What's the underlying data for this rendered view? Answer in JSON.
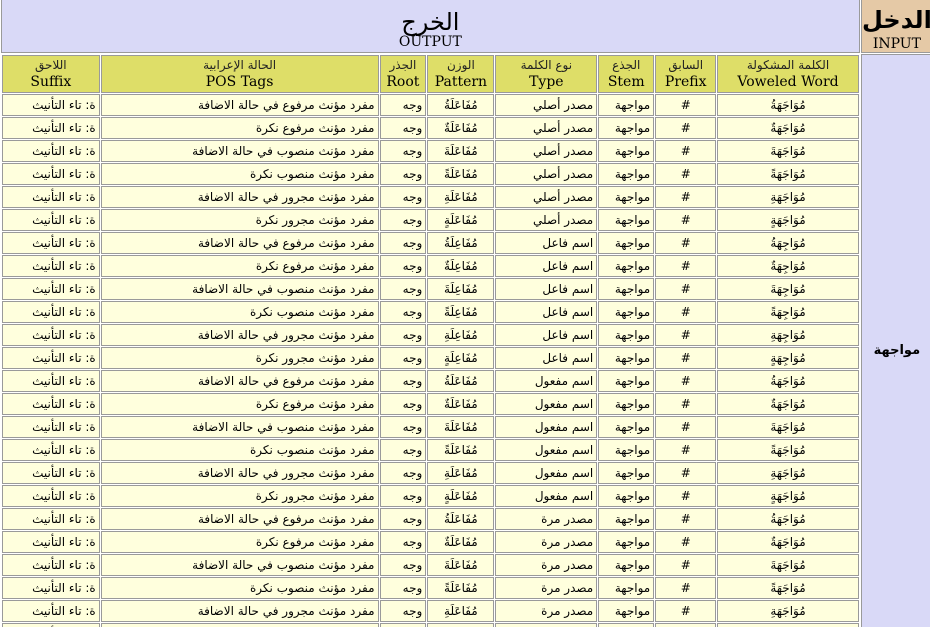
{
  "header": {
    "output_ar": "الخرج",
    "output_en": "OUTPUT",
    "input_ar": "الدخل",
    "input_en": "INPUT"
  },
  "input_word": "مواجهة",
  "columns": [
    {
      "ar": "اللاحق",
      "en": "Suffix"
    },
    {
      "ar": "الحالة الإعرابية",
      "en": "POS Tags"
    },
    {
      "ar": "الجذر",
      "en": "Root"
    },
    {
      "ar": "الوزن",
      "en": "Pattern"
    },
    {
      "ar": "نوع الكلمة",
      "en": "Type"
    },
    {
      "ar": "الجذع",
      "en": "Stem"
    },
    {
      "ar": "السابق",
      "en": "Prefix"
    },
    {
      "ar": "الكلمة المشكولة",
      "en": "Voweled Word"
    }
  ],
  "rows": [
    {
      "suffix": "ة: تاء التأنيث",
      "pos": "مفرد مؤنث مرفوع في حالة الاضافة",
      "root": "وجه",
      "pattern": "مُفَاعَلَةُ",
      "type": "مصدر أصلي",
      "stem": "مواجهة",
      "prefix": "#",
      "voweled": "مُوَاجَهَةُ"
    },
    {
      "suffix": "ة: تاء التأنيث",
      "pos": "مفرد مؤنث مرفوع نكرة",
      "root": "وجه",
      "pattern": "مُفَاعَلَةٌ",
      "type": "مصدر أصلي",
      "stem": "مواجهة",
      "prefix": "#",
      "voweled": "مُوَاجَهَةٌ"
    },
    {
      "suffix": "ة: تاء التأنيث",
      "pos": "مفرد مؤنث منصوب في حالة الاضافة",
      "root": "وجه",
      "pattern": "مُفَاعَلَةَ",
      "type": "مصدر أصلي",
      "stem": "مواجهة",
      "prefix": "#",
      "voweled": "مُوَاجَهَةَ"
    },
    {
      "suffix": "ة: تاء التأنيث",
      "pos": "مفرد مؤنث منصوب نكرة",
      "root": "وجه",
      "pattern": "مُفَاعَلَةً",
      "type": "مصدر أصلي",
      "stem": "مواجهة",
      "prefix": "#",
      "voweled": "مُوَاجَهَةً"
    },
    {
      "suffix": "ة: تاء التأنيث",
      "pos": "مفرد مؤنث مجرور في حالة الاضافة",
      "root": "وجه",
      "pattern": "مُفَاعَلَةِ",
      "type": "مصدر أصلي",
      "stem": "مواجهة",
      "prefix": "#",
      "voweled": "مُوَاجَهَةِ"
    },
    {
      "suffix": "ة: تاء التأنيث",
      "pos": "مفرد مؤنث مجرور نكرة",
      "root": "وجه",
      "pattern": "مُفَاعَلَةٍ",
      "type": "مصدر أصلي",
      "stem": "مواجهة",
      "prefix": "#",
      "voweled": "مُوَاجَهَةٍ"
    },
    {
      "suffix": "ة: تاء التأنيث",
      "pos": "مفرد مؤنث مرفوع في حالة الاضافة",
      "root": "وجه",
      "pattern": "مُفَاعِلَةُ",
      "type": "اسم فاعل",
      "stem": "مواجهة",
      "prefix": "#",
      "voweled": "مُوَاجِهَةُ"
    },
    {
      "suffix": "ة: تاء التأنيث",
      "pos": "مفرد مؤنث مرفوع نكرة",
      "root": "وجه",
      "pattern": "مُفَاعِلَةٌ",
      "type": "اسم فاعل",
      "stem": "مواجهة",
      "prefix": "#",
      "voweled": "مُوَاجِهَةٌ"
    },
    {
      "suffix": "ة: تاء التأنيث",
      "pos": "مفرد مؤنث منصوب في حالة الاضافة",
      "root": "وجه",
      "pattern": "مُفَاعِلَةَ",
      "type": "اسم فاعل",
      "stem": "مواجهة",
      "prefix": "#",
      "voweled": "مُوَاجِهَةَ"
    },
    {
      "suffix": "ة: تاء التأنيث",
      "pos": "مفرد مؤنث منصوب نكرة",
      "root": "وجه",
      "pattern": "مُفَاعِلَةً",
      "type": "اسم فاعل",
      "stem": "مواجهة",
      "prefix": "#",
      "voweled": "مُوَاجِهَةً"
    },
    {
      "suffix": "ة: تاء التأنيث",
      "pos": "مفرد مؤنث مجرور في حالة الاضافة",
      "root": "وجه",
      "pattern": "مُفَاعِلَةِ",
      "type": "اسم فاعل",
      "stem": "مواجهة",
      "prefix": "#",
      "voweled": "مُوَاجِهَةِ"
    },
    {
      "suffix": "ة: تاء التأنيث",
      "pos": "مفرد مؤنث مجرور نكرة",
      "root": "وجه",
      "pattern": "مُفَاعِلَةٍ",
      "type": "اسم فاعل",
      "stem": "مواجهة",
      "prefix": "#",
      "voweled": "مُوَاجِهَةٍ"
    },
    {
      "suffix": "ة: تاء التأنيث",
      "pos": "مفرد مؤنث مرفوع في حالة الاضافة",
      "root": "وجه",
      "pattern": "مُفَاعَلَةُ",
      "type": "اسم مفعول",
      "stem": "مواجهة",
      "prefix": "#",
      "voweled": "مُوَاجَهَةُ"
    },
    {
      "suffix": "ة: تاء التأنيث",
      "pos": "مفرد مؤنث مرفوع نكرة",
      "root": "وجه",
      "pattern": "مُفَاعَلَةٌ",
      "type": "اسم مفعول",
      "stem": "مواجهة",
      "prefix": "#",
      "voweled": "مُوَاجَهَةٌ"
    },
    {
      "suffix": "ة: تاء التأنيث",
      "pos": "مفرد مؤنث منصوب في حالة الاضافة",
      "root": "وجه",
      "pattern": "مُفَاعَلَةَ",
      "type": "اسم مفعول",
      "stem": "مواجهة",
      "prefix": "#",
      "voweled": "مُوَاجَهَةَ"
    },
    {
      "suffix": "ة: تاء التأنيث",
      "pos": "مفرد مؤنث منصوب نكرة",
      "root": "وجه",
      "pattern": "مُفَاعَلَةً",
      "type": "اسم مفعول",
      "stem": "مواجهة",
      "prefix": "#",
      "voweled": "مُوَاجَهَةً"
    },
    {
      "suffix": "ة: تاء التأنيث",
      "pos": "مفرد مؤنث مجرور في حالة الاضافة",
      "root": "وجه",
      "pattern": "مُفَاعَلَةِ",
      "type": "اسم مفعول",
      "stem": "مواجهة",
      "prefix": "#",
      "voweled": "مُوَاجَهَةِ"
    },
    {
      "suffix": "ة: تاء التأنيث",
      "pos": "مفرد مؤنث مجرور نكرة",
      "root": "وجه",
      "pattern": "مُفَاعَلَةٍ",
      "type": "اسم مفعول",
      "stem": "مواجهة",
      "prefix": "#",
      "voweled": "مُوَاجَهَةٍ"
    },
    {
      "suffix": "ة: تاء التأنيث",
      "pos": "مفرد مؤنث مرفوع في حالة الاضافة",
      "root": "وجه",
      "pattern": "مُفَاعَلَةُ",
      "type": "مصدر مرة",
      "stem": "مواجهة",
      "prefix": "#",
      "voweled": "مُوَاجَهَةُ"
    },
    {
      "suffix": "ة: تاء التأنيث",
      "pos": "مفرد مؤنث مرفوع نكرة",
      "root": "وجه",
      "pattern": "مُفَاعَلَةٌ",
      "type": "مصدر مرة",
      "stem": "مواجهة",
      "prefix": "#",
      "voweled": "مُوَاجَهَةٌ"
    },
    {
      "suffix": "ة: تاء التأنيث",
      "pos": "مفرد مؤنث منصوب في حالة الاضافة",
      "root": "وجه",
      "pattern": "مُفَاعَلَةَ",
      "type": "مصدر مرة",
      "stem": "مواجهة",
      "prefix": "#",
      "voweled": "مُوَاجَهَةَ"
    },
    {
      "suffix": "ة: تاء التأنيث",
      "pos": "مفرد مؤنث منصوب نكرة",
      "root": "وجه",
      "pattern": "مُفَاعَلَةً",
      "type": "مصدر مرة",
      "stem": "مواجهة",
      "prefix": "#",
      "voweled": "مُوَاجَهَةً"
    },
    {
      "suffix": "ة: تاء التأنيث",
      "pos": "مفرد مؤنث مجرور في حالة الاضافة",
      "root": "وجه",
      "pattern": "مُفَاعَلَةِ",
      "type": "مصدر مرة",
      "stem": "مواجهة",
      "prefix": "#",
      "voweled": "مُوَاجَهَةِ"
    },
    {
      "suffix": "ة: تاء التأنيث",
      "pos": "مفرد مؤنث مجرور نكرة",
      "root": "وجه",
      "pattern": "مُفَاعَلَةٍ",
      "type": "مصدر مرة",
      "stem": "مواجهة",
      "prefix": "#",
      "voweled": "مُوَاجَهَةٍ"
    }
  ]
}
